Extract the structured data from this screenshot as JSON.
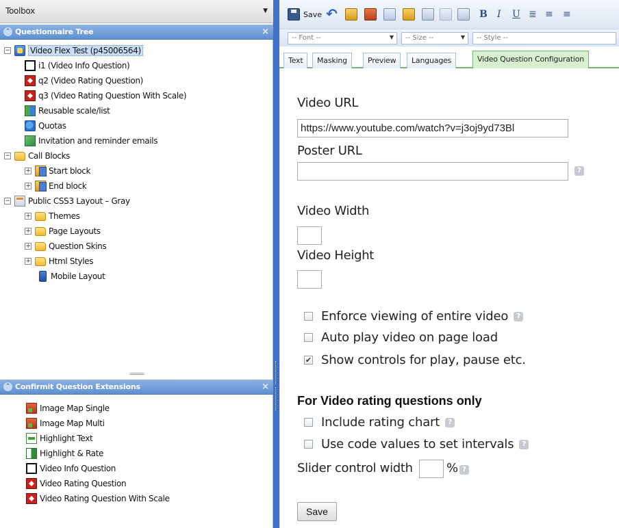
{
  "toolbox": {
    "title": "Toolbox"
  },
  "questionnaire_tree": {
    "title": "Questionnaire Tree",
    "items": [
      {
        "label": "Video Flex Test (p45006564)",
        "icon": "survey-icon"
      },
      {
        "label": "i1 (Video Info Question)",
        "icon": "video-info-icon"
      },
      {
        "label": "q2 (Video Rating Question)",
        "icon": "video-rating-icon"
      },
      {
        "label": "q3 (Video Rating Question With Scale)",
        "icon": "video-rating-icon"
      },
      {
        "label": "Reusable scale/list",
        "icon": "scale-list-icon"
      },
      {
        "label": "Quotas",
        "icon": "quotas-icon"
      },
      {
        "label": "Invitation and reminder emails",
        "icon": "email-icon"
      },
      {
        "label": "Call Blocks",
        "icon": "folder-icon"
      },
      {
        "label": "Start block",
        "icon": "block-icon"
      },
      {
        "label": "End block",
        "icon": "block-icon"
      },
      {
        "label": "Public CSS3 Layout – Gray",
        "icon": "layout-icon"
      },
      {
        "label": "Themes",
        "icon": "folder-icon"
      },
      {
        "label": "Page Layouts",
        "icon": "folder-icon"
      },
      {
        "label": "Question Skins",
        "icon": "folder-icon"
      },
      {
        "label": "Html Styles",
        "icon": "folder-icon"
      },
      {
        "label": "Mobile Layout",
        "icon": "mobile-icon"
      }
    ]
  },
  "extensions": {
    "title": "Confirmit Question Extensions",
    "items": [
      {
        "label": "Image Map Single",
        "icon": "image-map-icon"
      },
      {
        "label": "Image Map Multi",
        "icon": "image-map-icon"
      },
      {
        "label": "Highlight Text",
        "icon": "highlight-icon"
      },
      {
        "label": "Highlight & Rate",
        "icon": "highlight-rate-icon"
      },
      {
        "label": "Video Info Question",
        "icon": "video-info-icon"
      },
      {
        "label": "Video Rating Question",
        "icon": "video-rating-icon"
      },
      {
        "label": "Video Rating Question With Scale",
        "icon": "video-rating-icon"
      }
    ]
  },
  "editor_toolbar": {
    "save_label": "Save",
    "font_placeholder": "-- Font --",
    "size_placeholder": "-- Size --",
    "style_placeholder": "-- Style --"
  },
  "tabs": [
    {
      "label": "Text"
    },
    {
      "label": "Masking"
    },
    {
      "label": "Preview"
    },
    {
      "label": "Languages"
    },
    {
      "label": "Video Question Configuration",
      "active": true
    }
  ],
  "form": {
    "video_url_label": "Video URL",
    "video_url_value": "https://www.youtube.com/watch?v=j3oj9yd73Bl",
    "poster_url_label": "Poster URL",
    "poster_url_value": "",
    "video_width_label": "Video Width",
    "video_height_label": "Video Height",
    "enforce_label": "Enforce viewing of entire video",
    "enforce_checked": false,
    "autoplay_label": "Auto play video on page load",
    "autoplay_checked": false,
    "controls_label": "Show controls for play, pause etc.",
    "controls_checked": true,
    "rating_heading": "For Video rating questions only",
    "rating_chart_label": "Include rating chart",
    "rating_chart_checked": false,
    "code_values_label": "Use code values to set intervals",
    "code_values_checked": false,
    "slider_width_label": "Slider control width",
    "slider_width_unit": "%",
    "save_button": "Save"
  },
  "colors": {
    "panel_header": "#5f8fd1",
    "splitter": "#3f70c9",
    "active_tab": "#d8f0d0"
  }
}
